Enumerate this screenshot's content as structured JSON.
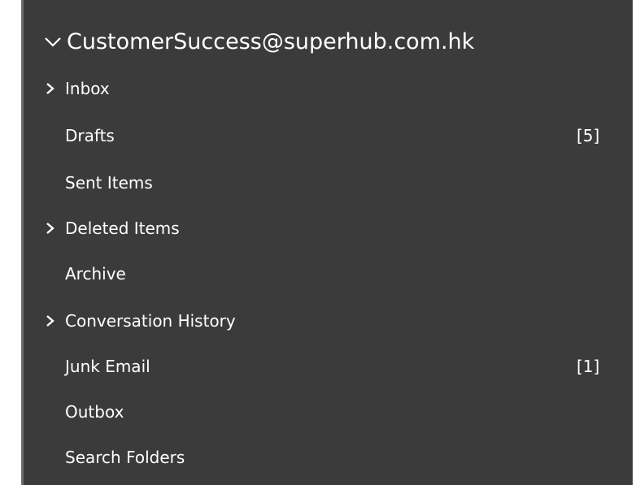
{
  "colors": {
    "panel_background": "#3b3b3b",
    "text": "#ffffff",
    "left_border": "#6e6e6e"
  },
  "account": {
    "label": "CustomerSuccess@superhub.com.hk",
    "icon": "chevron-down-icon",
    "expanded": true
  },
  "folders": [
    {
      "label": "Inbox",
      "count": "",
      "expandable": true,
      "icon": "chevron-right-icon"
    },
    {
      "label": "Drafts",
      "count": "[5]",
      "expandable": false
    },
    {
      "label": "Sent Items",
      "count": "",
      "expandable": false
    },
    {
      "label": "Deleted Items",
      "count": "",
      "expandable": true,
      "icon": "chevron-right-icon"
    },
    {
      "label": "Archive",
      "count": "",
      "expandable": false
    },
    {
      "label": "Conversation History",
      "count": "",
      "expandable": true,
      "icon": "chevron-right-icon"
    },
    {
      "label": "Junk Email",
      "count": "[1]",
      "expandable": false
    },
    {
      "label": "Outbox",
      "count": "",
      "expandable": false
    },
    {
      "label": "Search Folders",
      "count": "",
      "expandable": false
    }
  ]
}
